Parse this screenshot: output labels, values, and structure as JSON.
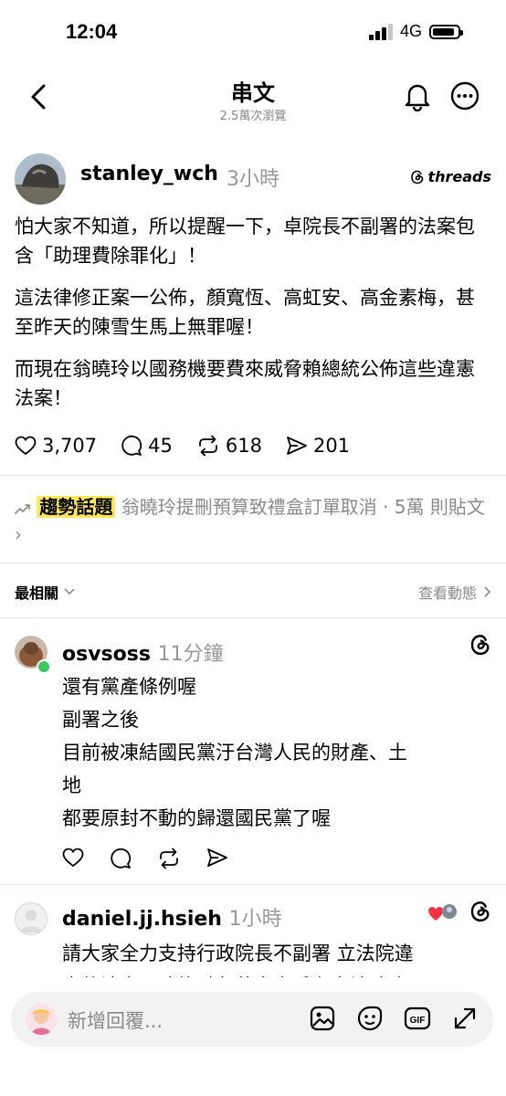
{
  "status_bar": {
    "time": "12:04",
    "network": "4G"
  },
  "header": {
    "title": "串文",
    "views": "2.5萬次瀏覽"
  },
  "post": {
    "username": "stanley_wch",
    "time": "3小時",
    "brand": "threads",
    "paragraphs": [
      "怕大家不知道，所以提醒一下，卓院長不副署的法案包含「助理費除罪化」！",
      "這法律修正案一公佈，顏寬恆、高虹安、高金素梅，甚至昨天的陳雪生馬上無罪喔！",
      "而現在翁曉玲以國務機要費來威脅賴總統公佈這些違憲法案！"
    ],
    "stats": {
      "likes": "3,707",
      "comments": "45",
      "reposts": "618",
      "shares": "201"
    }
  },
  "trending": {
    "tag": "趨勢話題",
    "text": "翁曉玲提刪預算致禮盒訂單取消 · 5萬 則貼文 ›"
  },
  "sort": {
    "label": "最相關",
    "activity": "查看動態"
  },
  "replies": [
    {
      "username": "osvsoss",
      "time": "11分鐘",
      "lines": [
        "還有黨產條例喔",
        "副署之後",
        "目前被凍結國民黨汙台灣人民的財產、土",
        "地",
        "都要原封不動的歸還國民黨了喔"
      ]
    },
    {
      "username": "daniel.jj.hsieh",
      "time": "1小時",
      "lines": [
        "請大家全力支持行政院長不副署 立法院違",
        "憲的法案，才能避免藍白立委在立法院違"
      ]
    }
  ],
  "input": {
    "placeholder": "新增回覆..."
  },
  "colors": {
    "trend_highlight": "#ffe95a",
    "muted": "#8a8a8a",
    "online": "#3cc85a"
  }
}
